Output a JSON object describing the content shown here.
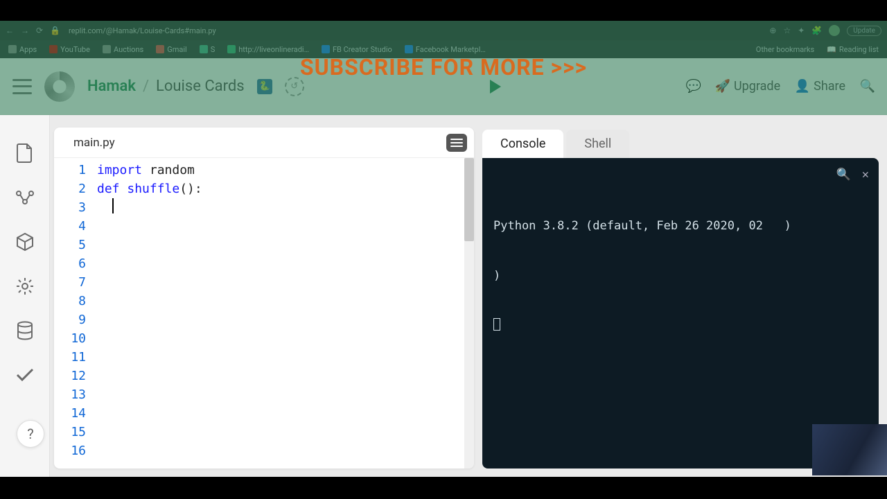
{
  "banner": "SUBSCRIBE FOR MORE >>>",
  "browser": {
    "url": "replit.com/@Hamak/Louise-Cards#main.py",
    "update_label": "Update",
    "bookmarks": [
      {
        "label": "Apps",
        "color": "#888"
      },
      {
        "label": "YouTube",
        "color": "#cc0000"
      },
      {
        "label": "Auctions",
        "color": "#888"
      },
      {
        "label": "Gmail",
        "color": "#d44"
      },
      {
        "label": "S",
        "color": "#4a8"
      },
      {
        "label": "http://liveonlineradi…",
        "color": "#3a7"
      },
      {
        "label": "FB Creator Studio",
        "color": "#1877f2"
      },
      {
        "label": "Facebook Marketpl…",
        "color": "#1877f2"
      }
    ],
    "right_bookmarks": [
      {
        "label": "Other bookmarks"
      },
      {
        "label": "Reading list"
      }
    ]
  },
  "header": {
    "owner": "Hamak",
    "separator": "/",
    "repl_name": "Louise Cards",
    "upgrade": "Upgrade",
    "share": "Share"
  },
  "editor": {
    "tab_name": "main.py",
    "line_count": 16,
    "code": {
      "l1_kw": "import",
      "l1_rest": " random",
      "l2_kw": "def",
      "l2_fn": " shuffle",
      "l2_rest": "():"
    }
  },
  "console": {
    "tabs": {
      "console": "Console",
      "shell": "Shell"
    },
    "output_line1": "Python 3.8.2 (default, Feb 26 2020, 02   )",
    "output_line2": ")"
  },
  "help_label": "?"
}
